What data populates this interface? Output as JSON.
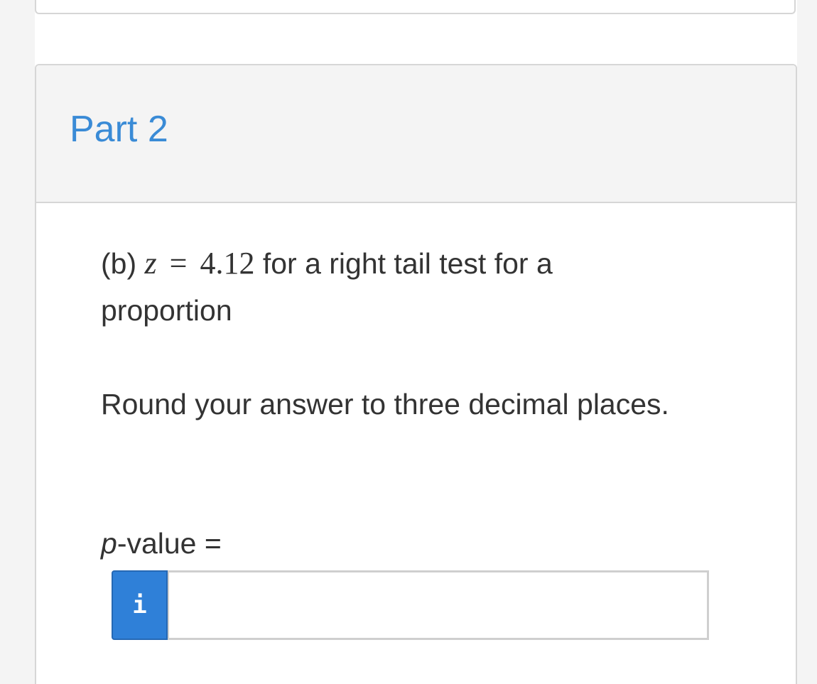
{
  "part": {
    "title": "Part 2"
  },
  "question": {
    "prefix": "(b) ",
    "variable": "z",
    "operator": "=",
    "value": "4.12",
    "suffix": " for a right tail test for a proportion"
  },
  "instructions": {
    "text": "Round your answer to three decimal places."
  },
  "answer": {
    "label_var": "p",
    "label_rest": "-value =",
    "info_glyph": "i",
    "input_value": "",
    "input_placeholder": ""
  },
  "colors": {
    "title": "#3a8bd6",
    "info_button": "#2f80d8",
    "header_bg": "#f4f4f4",
    "border": "#d6d6d6"
  },
  "icons": {
    "info_button": "info-icon"
  }
}
